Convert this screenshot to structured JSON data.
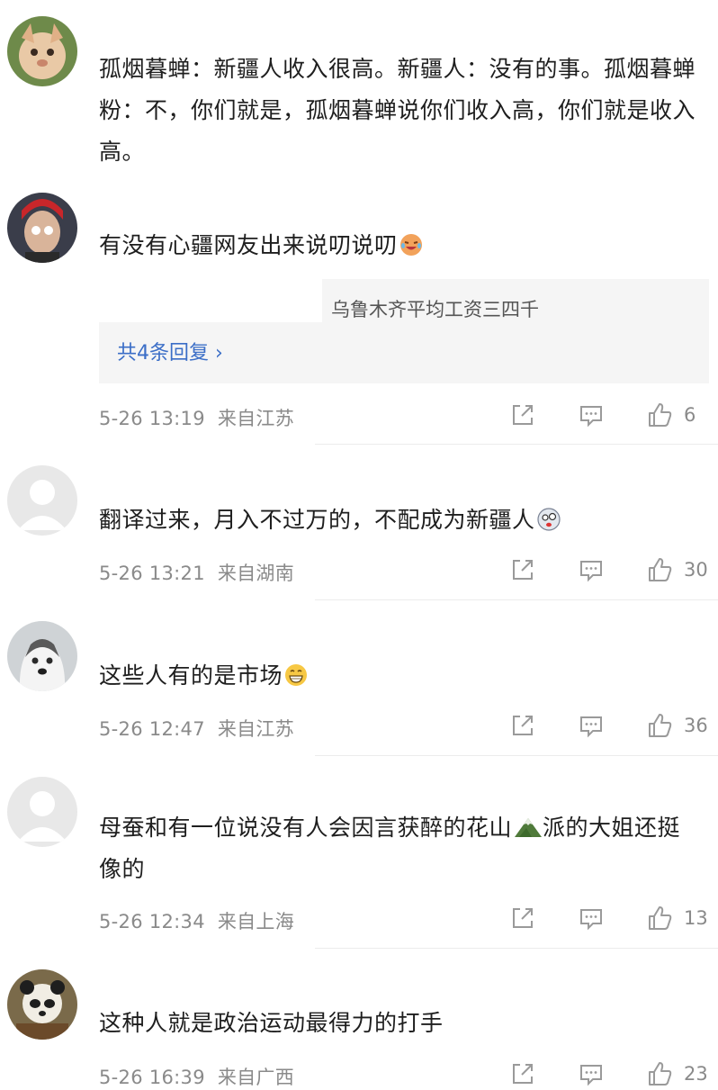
{
  "comments": [
    {
      "text": "孤烟暮蝉：新疆人收入很高。新疆人：没有的事。孤烟暮蝉粉：不，你们就是，孤烟暮蝉说你们收入高，你们就是收入高。",
      "avatar": "cartoon-fox"
    },
    {
      "text": "有没有心疆网友出来说叨说叨",
      "emoji": "laughing-crying-face",
      "reply_preview": "乌鲁木齐平均工资三四千",
      "reply_more": "共4条回复 ›",
      "date": "5-26 13:19",
      "location": "来自江苏",
      "likes": "6",
      "avatar": "person-red-hair"
    },
    {
      "text": "翻译过来，月入不过万的，不配成为新疆人",
      "emoji": "dizzy-face",
      "date": "5-26 13:21",
      "location": "来自湖南",
      "likes": "30",
      "avatar": "default-user"
    },
    {
      "text": "这些人有的是市场",
      "emoji": "grinning-face",
      "date": "5-26 12:47",
      "location": "来自江苏",
      "likes": "36",
      "avatar": "husky-dog"
    },
    {
      "text": "母蚕和有一位说没有人会因言获醉的花山",
      "emoji": "mountain",
      "text_after": "派的大姐还挺像的",
      "date": "5-26 12:34",
      "location": "来自上海",
      "likes": "13",
      "avatar": "default-user"
    },
    {
      "text": "这种人就是政治运动最得力的打手",
      "date": "5-26 16:39",
      "location": "来自广西",
      "likes": "23",
      "avatar": "panda"
    }
  ],
  "colors": {
    "meta": "#8a8a8a",
    "link": "#3b6ec7",
    "reply_bg": "#f5f5f5"
  }
}
